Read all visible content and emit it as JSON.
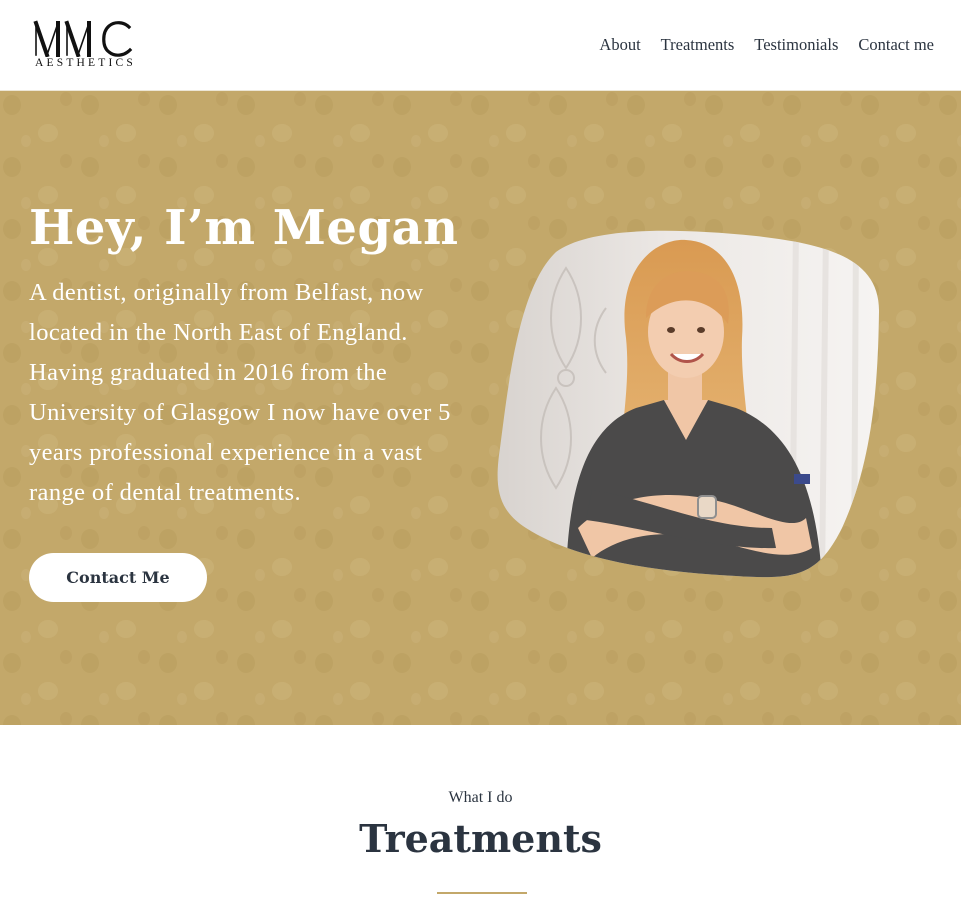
{
  "header": {
    "logo_mark": "MMC",
    "logo_sub": "AESTHETICS",
    "nav": [
      {
        "label": "About"
      },
      {
        "label": "Treatments"
      },
      {
        "label": "Testimonials"
      },
      {
        "label": "Contact me"
      }
    ]
  },
  "hero": {
    "title": "Hey, I’m Megan",
    "text": "A dentist, originally from Belfast, now located in the North East of England. Having graduated in 2016 from the University of Glasgow I now have over 5 years professional experience in a vast range of dental treatments.",
    "cta_label": "Contact Me",
    "photo_icon": "portrait-photo",
    "background_color": "#c3a86a"
  },
  "section": {
    "kicker": "What I do",
    "title": "Treatments",
    "accent_color": "#c3a86a"
  }
}
